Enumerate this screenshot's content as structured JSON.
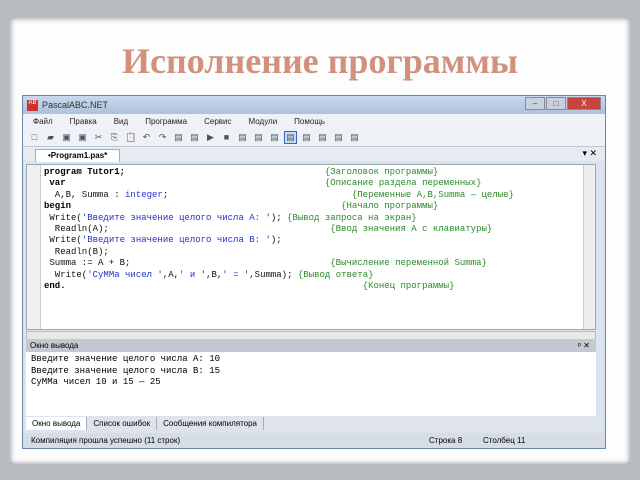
{
  "slide": {
    "title": "Исполнение программы"
  },
  "window": {
    "title": "PascalABC.NET",
    "buttons": [
      "–",
      "□",
      "X"
    ]
  },
  "menu": [
    "Файл",
    "Правка",
    "Вид",
    "Программа",
    "Сервис",
    "Модули",
    "Помощь"
  ],
  "toolbar": [
    "new-icon",
    "open-icon",
    "save-icon",
    "save-all-icon",
    "cut-icon",
    "copy-icon",
    "paste-icon",
    "undo-icon",
    "redo-icon",
    "find-icon",
    "replace-icon",
    "run-icon",
    "stop-icon",
    "compile-icon",
    "step-into-icon",
    "step-over-icon",
    "output-window-icon",
    "form-icon",
    "debug1-icon",
    "debug2-icon",
    "debug3-icon"
  ],
  "file_tab": {
    "label": "•Program1.pas*"
  },
  "code": [
    [
      {
        "t": "program Tutor1;",
        "s": "kw"
      },
      {
        "t": "                                     ",
        "s": ""
      },
      {
        "t": "{Заголовок программы}",
        "s": "cm"
      }
    ],
    [
      {
        "t": " var",
        "s": "kw"
      },
      {
        "t": "                                                ",
        "s": ""
      },
      {
        "t": "{Описание раздела переменных}",
        "s": "cm"
      }
    ],
    [
      {
        "t": "  A,B, Summa : ",
        "s": ""
      },
      {
        "t": "integer",
        "s": "ty"
      },
      {
        "t": ";",
        "s": ""
      },
      {
        "t": "                                  ",
        "s": ""
      },
      {
        "t": "{Переменные A,B,Summa — целые}",
        "s": "cm"
      }
    ],
    [
      {
        "t": "begin",
        "s": "kw"
      },
      {
        "t": "                                                  ",
        "s": ""
      },
      {
        "t": "{Начало программы}",
        "s": "cm"
      }
    ],
    [
      {
        "t": " Write(",
        "s": ""
      },
      {
        "t": "'Введите значение целого числа А: '",
        "s": "str"
      },
      {
        "t": "); ",
        "s": ""
      },
      {
        "t": "{Вывод запроса на экран}",
        "s": "cm"
      }
    ],
    [
      {
        "t": "  Readln(A);",
        "s": ""
      },
      {
        "t": "                                         ",
        "s": ""
      },
      {
        "t": "{Ввод значения А с клавиатуры}",
        "s": "cm"
      }
    ],
    [
      {
        "t": " Write(",
        "s": ""
      },
      {
        "t": "'Введите значение целого числа В: '",
        "s": "str"
      },
      {
        "t": ");",
        "s": ""
      }
    ],
    [
      {
        "t": "  Readln(B);",
        "s": ""
      }
    ],
    [
      {
        "t": " Summa := A + B;",
        "s": ""
      },
      {
        "t": "                                     ",
        "s": ""
      },
      {
        "t": "{Вычисление переменной Summa}",
        "s": "cm"
      }
    ],
    [
      {
        "t": "  Write(",
        "s": ""
      },
      {
        "t": "'СуММа чисел '",
        "s": "str"
      },
      {
        "t": ",A,",
        "s": ""
      },
      {
        "t": "' и '",
        "s": "str"
      },
      {
        "t": ",B,",
        "s": ""
      },
      {
        "t": "' = '",
        "s": "str"
      },
      {
        "t": ",Summa); ",
        "s": ""
      },
      {
        "t": "{Вывод ответа}",
        "s": "cm"
      }
    ],
    [
      {
        "t": "end.",
        "s": "kw"
      },
      {
        "t": "                                                       ",
        "s": ""
      },
      {
        "t": "{Конец программы}",
        "s": "cm"
      }
    ]
  ],
  "output_panel": {
    "title": "Окно вывода",
    "lines": [
      "Введите значение целого числа А: 10",
      "Введите значение целого числа В: 15",
      "СуММа чисел 10 и 15 — 25"
    ]
  },
  "output_tabs": [
    "Окно вывода",
    "Список ошибок",
    "Сообщения компилятора"
  ],
  "status": {
    "message": "Компиляция прошла успешно (11 строк)",
    "line": "Строка  8",
    "column": "Столбец  11"
  }
}
